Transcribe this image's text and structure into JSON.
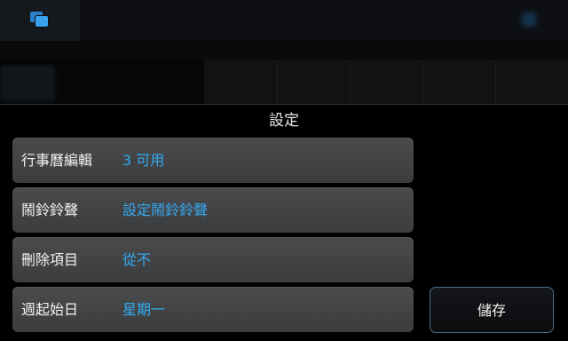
{
  "dialog": {
    "title": "設定",
    "settings": [
      {
        "label": "行事曆編輯",
        "value": "3 可用"
      },
      {
        "label": "鬧鈴鈴聲",
        "value": "設定鬧鈴鈴聲"
      },
      {
        "label": "刪除項目",
        "value": "從不"
      },
      {
        "label": "週起始日",
        "value": "星期一"
      }
    ],
    "save_label": "儲存"
  },
  "colors": {
    "accent": "#33aaf0",
    "button_border": "#4b6d86"
  },
  "icons": {
    "app_icon": "calendar-app-icon"
  }
}
